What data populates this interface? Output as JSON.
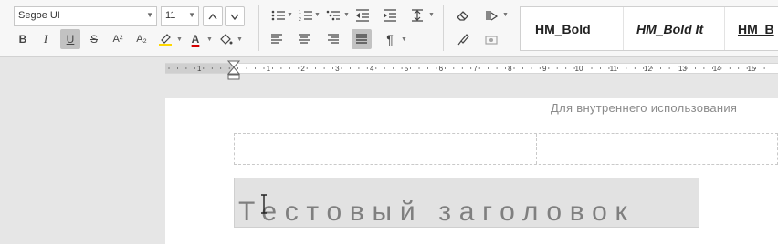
{
  "toolbar": {
    "font_name": "Segoe UI",
    "font_size": "11",
    "increase_font_icon": "caret-up-icon",
    "decrease_font_icon": "caret-down-icon",
    "bold_label": "B",
    "italic_label": "I",
    "underline_label": "U",
    "strike_label": "S",
    "superscript_label": "A²",
    "subscript_label": "A₂",
    "font_color_label": "A",
    "highlight_color": "#ffd800",
    "font_color": "#d40000"
  },
  "styles": {
    "items": [
      {
        "label": "HM_Bold"
      },
      {
        "label": "HM_Bold It"
      },
      {
        "label": "HM_B"
      }
    ]
  },
  "ruler": {
    "numbers": [
      "1",
      "1",
      "2",
      "3",
      "4",
      "5",
      "6",
      "7",
      "8",
      "9",
      "10",
      "11",
      "12",
      "13",
      "14",
      "15"
    ]
  },
  "document": {
    "header_text": "Для внутреннего использования",
    "title_text": "Тестовый заголовок"
  }
}
